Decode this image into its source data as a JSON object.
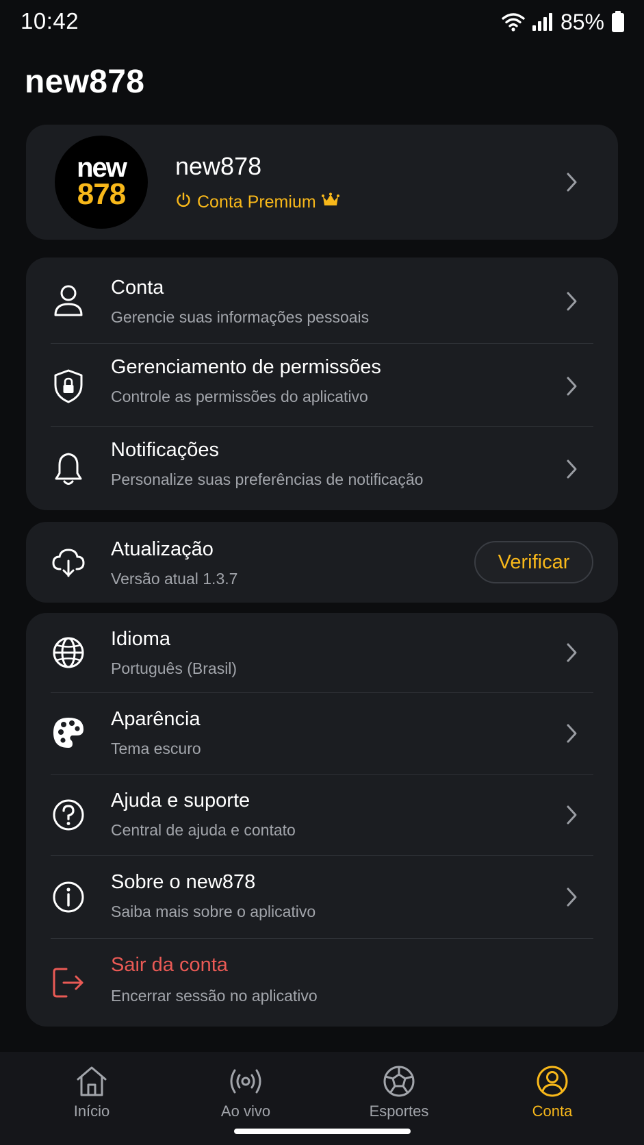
{
  "status_bar": {
    "time": "10:42",
    "battery": "85%"
  },
  "page_title": "new878",
  "profile": {
    "avatar_top": "new",
    "avatar_bottom": "878",
    "name": "new878",
    "badge": "Conta Premium"
  },
  "menu_group_1": [
    {
      "title": "Conta",
      "subtitle": "Gerencie suas informações pessoais",
      "icon": "user-icon"
    },
    {
      "title": "Gerenciamento de permissões",
      "subtitle": "Controle as permissões do aplicativo",
      "icon": "shield-lock-icon"
    },
    {
      "title": "Notificações",
      "subtitle": "Personalize suas preferências de notificação",
      "icon": "bell-icon"
    }
  ],
  "update": {
    "title": "Atualização",
    "subtitle": "Versão atual 1.3.7",
    "button": "Verificar",
    "icon": "cloud-download-icon"
  },
  "menu_group_2": [
    {
      "title": "Idioma",
      "subtitle": "Português (Brasil)",
      "icon": "globe-icon"
    },
    {
      "title": "Aparência",
      "subtitle": "Tema escuro",
      "icon": "palette-icon"
    },
    {
      "title": "Ajuda e suporte",
      "subtitle": "Central de ajuda e contato",
      "icon": "help-circle-icon"
    },
    {
      "title": "Sobre o new878",
      "subtitle": "Saiba mais sobre o aplicativo",
      "icon": "info-circle-icon"
    },
    {
      "title": "Sair da conta",
      "subtitle": "Encerrar sessão no aplicativo",
      "icon": "logout-icon"
    }
  ],
  "bottom_nav": [
    {
      "label": "Início",
      "icon": "home-icon",
      "active": false
    },
    {
      "label": "Ao vivo",
      "icon": "live-broadcast-icon",
      "active": false
    },
    {
      "label": "Esportes",
      "icon": "soccer-ball-icon",
      "active": false
    },
    {
      "label": "Conta",
      "icon": "account-circle-icon",
      "active": true
    }
  ],
  "colors": {
    "background": "#0c0d0f",
    "card": "#1b1d21",
    "accent": "#f8b81a",
    "danger": "#ea5a55",
    "muted_text": "#a2a5ab"
  }
}
